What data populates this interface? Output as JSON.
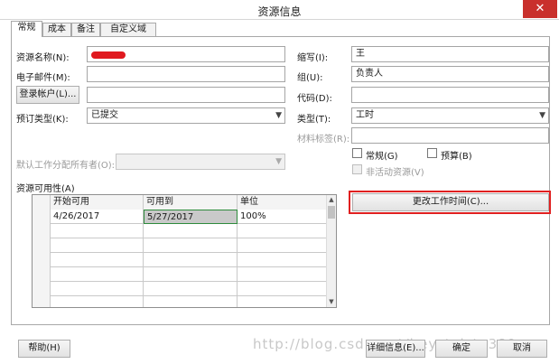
{
  "window": {
    "title": "资源信息",
    "close": "✕"
  },
  "tabs": [
    "常规",
    "成本",
    "备注",
    "自定义域"
  ],
  "form": {
    "name_label": "资源名称(N):",
    "name_value": "",
    "email_label": "电子邮件(M):",
    "email_value": "",
    "login_button": "登录帐户(L)...",
    "login_value": "",
    "booking_label": "预订类型(K):",
    "booking_value": "已提交",
    "owner_label": "默认工作分配所有者(O):",
    "owner_value": "",
    "initials_label": "缩写(I):",
    "initials_value": "王",
    "group_label": "组(U):",
    "group_value": "负责人",
    "code_label": "代码(D):",
    "code_value": "",
    "type_label": "类型(T):",
    "type_value": "工时",
    "material_label": "材料标签(R):",
    "material_value": "",
    "generic_label": "常规(G)",
    "budget_label": "预算(B)",
    "inactive_label": "非活动资源(V)"
  },
  "availability": {
    "label": "资源可用性(A)",
    "columns": [
      "开始可用",
      "可用到",
      "单位"
    ],
    "rows": [
      [
        "4/26/2017",
        "5/27/2017",
        "100%"
      ]
    ]
  },
  "buttons": {
    "change_worktime": "更改工作时间(C)...",
    "help": "帮助(H)",
    "details": "详细信息(E)...",
    "ok": "确定",
    "cancel": "取消"
  },
  "watermark": "http://blog.csdn.net/hey_tylsta389",
  "colors": {
    "redact": "#e0191f",
    "highlight": "#e02020",
    "close": "#c9302c"
  }
}
